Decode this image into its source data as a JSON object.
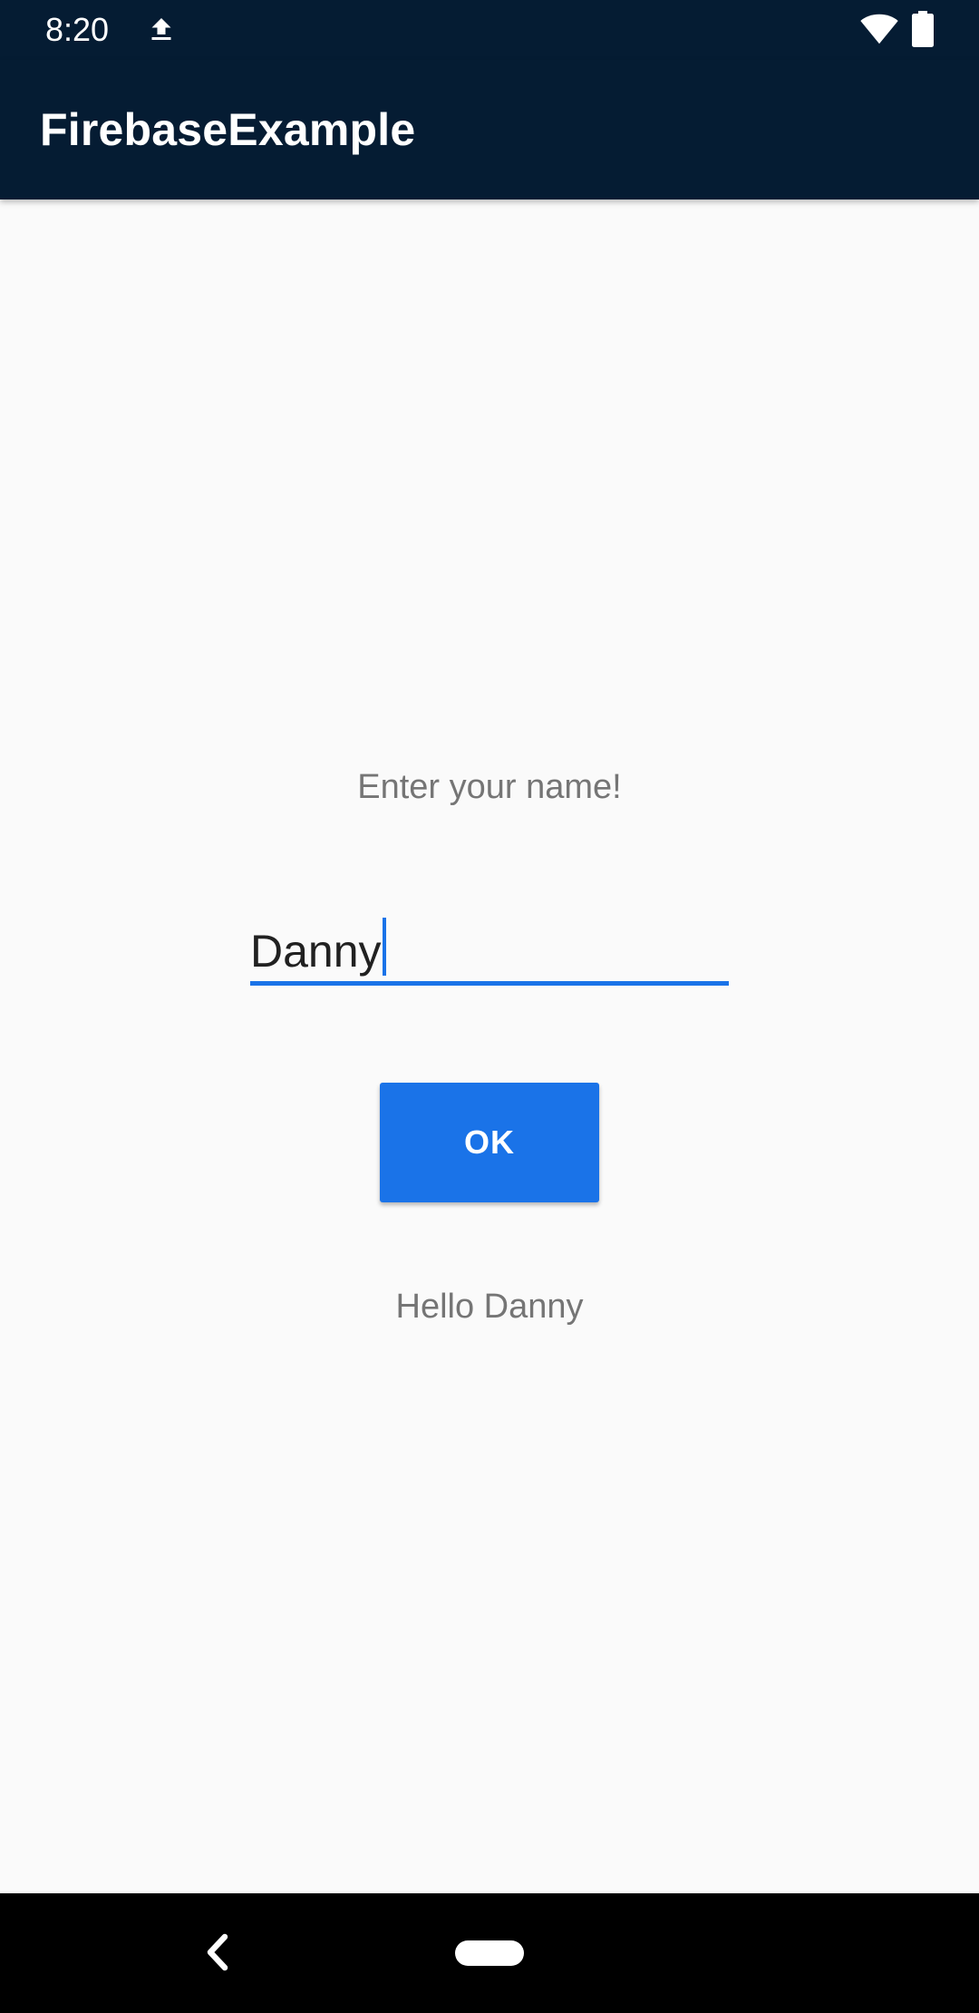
{
  "status_bar": {
    "time": "8:20",
    "icons": [
      "upload-icon",
      "wifi-icon",
      "battery-icon"
    ]
  },
  "app_bar": {
    "title": "FirebaseExample",
    "background": "#051c33"
  },
  "main": {
    "prompt": "Enter your name!",
    "name_field": {
      "value": "Danny",
      "placeholder": ""
    },
    "ok_button_label": "OK",
    "greeting": "Hello Danny"
  },
  "nav_bar": {
    "icons": [
      "back-icon",
      "home-icon"
    ]
  },
  "colors": {
    "accent": "#1a73e8",
    "text_secondary": "#757575",
    "background": "#fafafa"
  }
}
